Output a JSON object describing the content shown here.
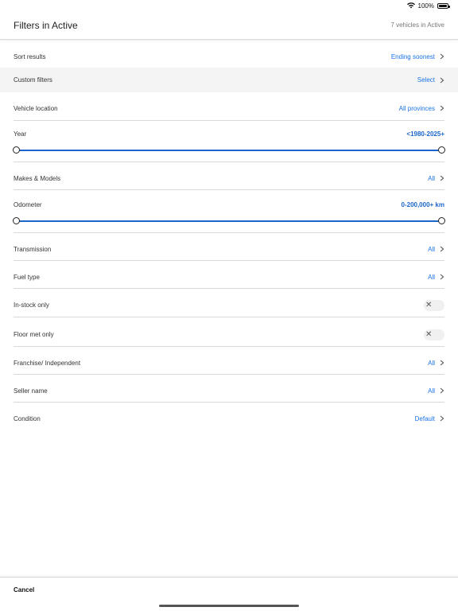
{
  "status": {
    "battery": "100%",
    "battery_level": 1.0
  },
  "header": {
    "title": "Filters in Active",
    "count": "7 vehicles in Active"
  },
  "rows": {
    "sort": {
      "label": "Sort results",
      "value": "Ending soonest"
    },
    "custom": {
      "label": "Custom filters",
      "value": "Select"
    },
    "location": {
      "label": "Vehicle location",
      "value": "All provinces"
    },
    "year": {
      "label": "Year",
      "value": "<1980-2025+",
      "range_min": 0.0,
      "range_max": 1.0
    },
    "makes": {
      "label": "Makes & Models",
      "value": "All"
    },
    "odometer": {
      "label": "Odometer",
      "value": "0-200,000+ km",
      "range_min": 0.0,
      "range_max": 1.0
    },
    "transmission": {
      "label": "Transmission",
      "value": "All"
    },
    "fuel": {
      "label": "Fuel type",
      "value": "All"
    },
    "instock": {
      "label": "In-stock only",
      "toggle_on": false
    },
    "floormet": {
      "label": "Floor met only",
      "toggle_on": false
    },
    "franchise": {
      "label": "Franchise/ Independent",
      "value": "All"
    },
    "seller": {
      "label": "Seller name",
      "value": "All"
    },
    "condition": {
      "label": "Condition",
      "value": "Default"
    }
  },
  "footer": {
    "cancel_label": "Cancel"
  },
  "colors": {
    "accent": "#1a73e8",
    "slider": "#1a66cc"
  },
  "icons": {
    "chevron": "chevron-right-icon",
    "toggle_off": "close-icon",
    "wifi": "wifi-icon",
    "battery": "battery-icon"
  }
}
